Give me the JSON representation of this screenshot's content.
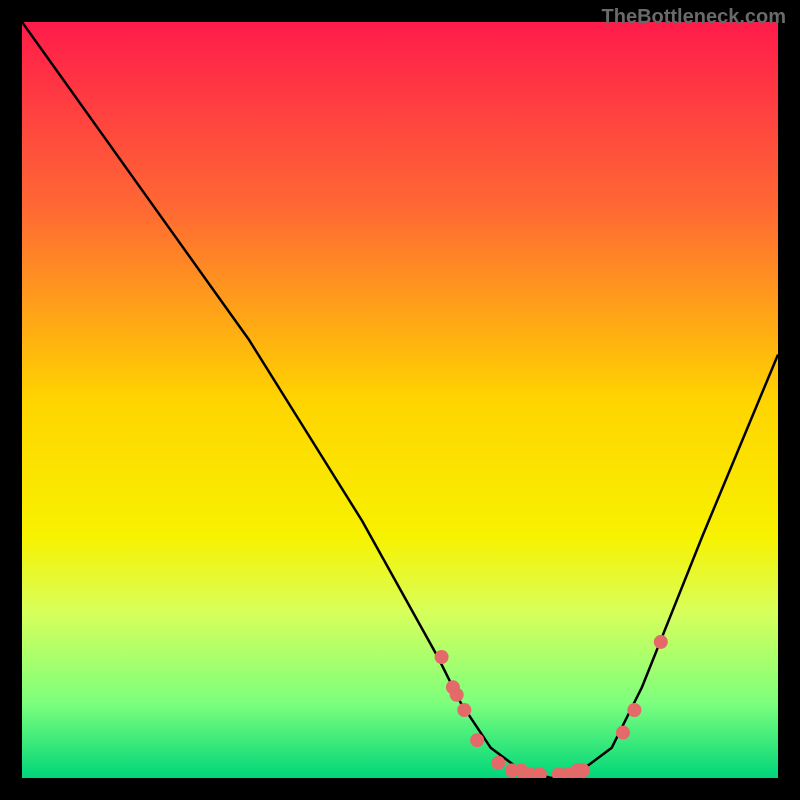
{
  "watermark": "TheBottleneck.com",
  "chart_data": {
    "type": "line",
    "title": "",
    "xlabel": "",
    "ylabel": "",
    "xlim": [
      0,
      100
    ],
    "ylim": [
      0,
      100
    ],
    "background": {
      "type": "vertical-gradient",
      "stops": [
        {
          "offset": 0,
          "color": "#ff1b4b"
        },
        {
          "offset": 25,
          "color": "#ff6a33"
        },
        {
          "offset": 50,
          "color": "#ffd400"
        },
        {
          "offset": 68,
          "color": "#f7f200"
        },
        {
          "offset": 78,
          "color": "#d8ff5a"
        },
        {
          "offset": 90,
          "color": "#7dff7d"
        },
        {
          "offset": 100,
          "color": "#00d67a"
        }
      ]
    },
    "series": [
      {
        "name": "bottleneck-curve",
        "color": "#000000",
        "x": [
          0,
          5,
          10,
          15,
          20,
          25,
          30,
          35,
          40,
          45,
          50,
          55,
          58,
          62,
          66,
          70,
          74,
          78,
          82,
          86,
          90,
          95,
          100
        ],
        "y": [
          100,
          93,
          86,
          79,
          72,
          65,
          58,
          50,
          42,
          34,
          25,
          16,
          10,
          4,
          1,
          0,
          1,
          4,
          12,
          22,
          32,
          44,
          56
        ]
      }
    ],
    "markers": {
      "name": "data-points",
      "color": "#e46a6a",
      "radius_px": 7,
      "points": [
        {
          "x": 55.5,
          "y": 16
        },
        {
          "x": 57.0,
          "y": 12
        },
        {
          "x": 57.5,
          "y": 11
        },
        {
          "x": 58.5,
          "y": 9
        },
        {
          "x": 60.2,
          "y": 5
        },
        {
          "x": 63.0,
          "y": 2
        },
        {
          "x": 64.8,
          "y": 1
        },
        {
          "x": 66.0,
          "y": 1
        },
        {
          "x": 67.2,
          "y": 0.5
        },
        {
          "x": 68.5,
          "y": 0.5
        },
        {
          "x": 71.0,
          "y": 0.5
        },
        {
          "x": 72.3,
          "y": 0.5
        },
        {
          "x": 73.5,
          "y": 1
        },
        {
          "x": 74.2,
          "y": 1
        },
        {
          "x": 79.5,
          "y": 6
        },
        {
          "x": 81.0,
          "y": 9
        },
        {
          "x": 84.5,
          "y": 18
        }
      ]
    }
  }
}
